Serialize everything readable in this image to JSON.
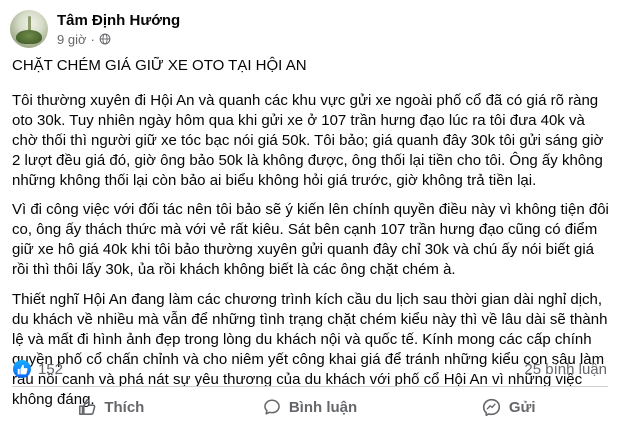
{
  "post": {
    "author": "Tâm Định Hướng",
    "time": "9 giờ",
    "separator": "·",
    "title": "CHẶT CHÉM GIÁ GIỮ XE OTO TẠI HỘI AN",
    "paragraphs": [
      "Tôi thường xuyên đi Hội An và quanh các khu vực gửi xe ngoài phố cổ đã có giá rõ ràng oto 30k. Tuy nhiên ngày hôm qua khi gửi xe ở 107 trần hưng đạo lúc ra tôi đưa 40k và chờ thối thì người giữ xe tóc bạc nói giá 50k. Tôi bảo; giá quanh đây 30k tôi gửi sáng giờ 2 lượt đều giá đó, giờ ông bảo 50k là không được, ông thối lại tiền cho tôi. Ông ấy không những không thối lại còn bảo ai biểu không hỏi giá trước, giờ không trả tiền lại.",
      "Vì đi công việc với đối tác nên tôi bảo sẽ ý kiến lên chính quyền điều này vì không tiện đôi co, ông ấy thách thức mà với vẻ rất kiêu. Sát bên cạnh 107 trần hưng đạo cũng có điểm giữ xe hô giá 40k khi tôi bảo thường xuyên gửi quanh đây chỉ 30k và chú ấy nói biết giá rồi thì thôi lấy 30k, ủa rồi khách không biết là các ông chặt chém à.",
      "Thiết nghĩ Hội An đang làm các chương trình kích cầu du lịch sau thời gian dài nghỉ dịch, du khách về nhiều mà vẫn để những tình trạng chặt chém kiểu này thì về lâu dài sẽ thành lệ và mất đi hình ảnh đẹp trong lòng du khách nội và quốc tế. Kính mong các cấp chính quyền phố cổ chấn chỉnh và cho niêm yết công khai giá để tránh những kiểu con sâu làm rầu nồi canh và phá nát sự yêu thương của du khách với phố cổ Hội An vì những việc không đáng."
    ],
    "reaction_count": "152",
    "comment_count": "25 bình luận"
  },
  "actions": {
    "like": "Thích",
    "comment": "Bình luận",
    "share": "Gửi"
  },
  "colors": {
    "accent": "#0866ff",
    "muted": "#65676b",
    "divider": "#ced0d4"
  },
  "icons": [
    "globe-icon",
    "like-badge-icon",
    "like-icon",
    "comment-icon",
    "messenger-icon"
  ]
}
